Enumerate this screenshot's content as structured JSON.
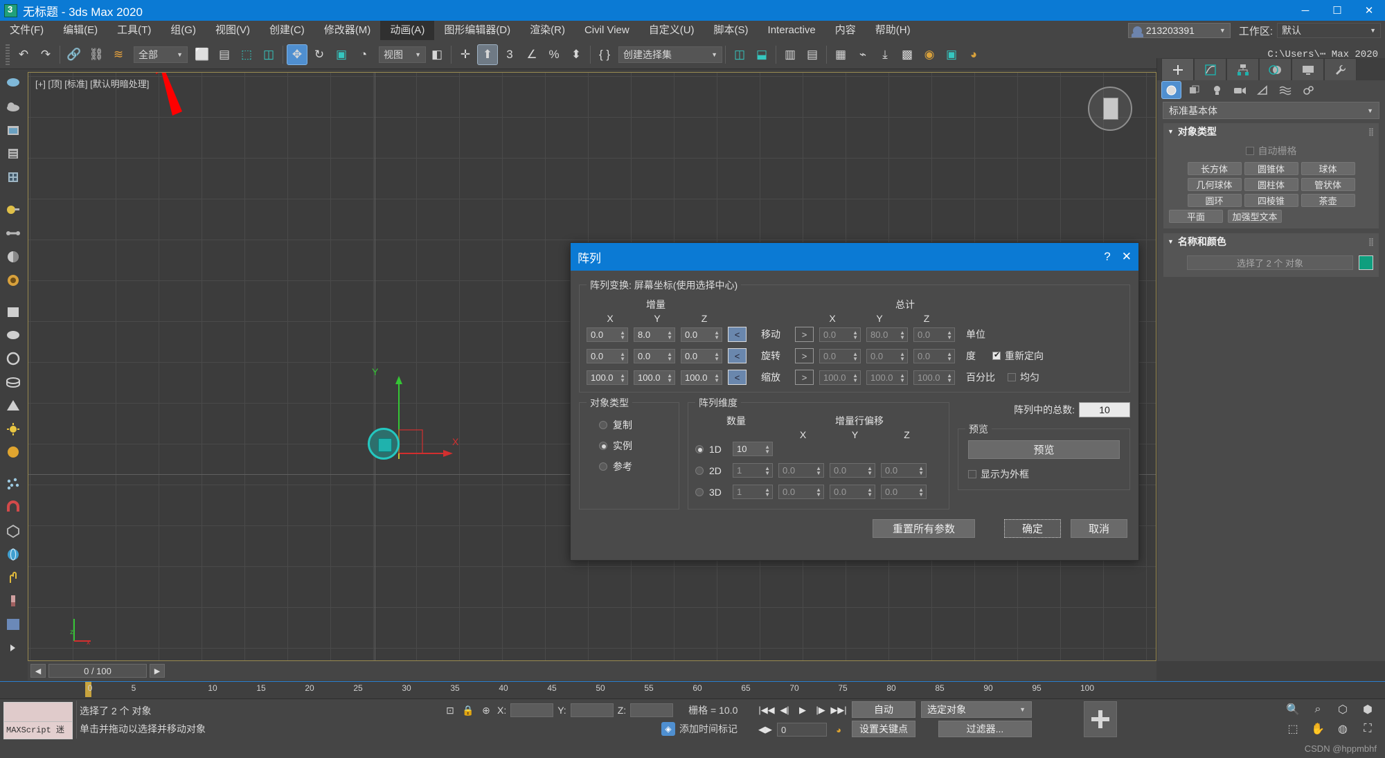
{
  "window": {
    "title": "无标题 - 3ds Max 2020",
    "icon": "3dsmax-icon",
    "controls": {
      "minimize": "─",
      "maximize": "☐",
      "close": "✕"
    }
  },
  "menubar": {
    "items": [
      {
        "label": "文件(F)",
        "active": false
      },
      {
        "label": "编辑(E)",
        "active": false
      },
      {
        "label": "工具(T)",
        "active": false
      },
      {
        "label": "组(G)",
        "active": false
      },
      {
        "label": "视图(V)",
        "active": false
      },
      {
        "label": "创建(C)",
        "active": false
      },
      {
        "label": "修改器(M)",
        "active": false
      },
      {
        "label": "动画(A)",
        "active": true
      },
      {
        "label": "图形编辑器(D)",
        "active": false
      },
      {
        "label": "渲染(R)",
        "active": false
      },
      {
        "label": "Civil View",
        "active": false
      },
      {
        "label": "自定义(U)",
        "active": false
      },
      {
        "label": "脚本(S)",
        "active": false
      },
      {
        "label": "Interactive",
        "active": false
      },
      {
        "label": "内容",
        "active": false
      },
      {
        "label": "帮助(H)",
        "active": false
      }
    ],
    "user_id": "213203391",
    "workspace_label": "工作区:",
    "workspace_value": "默认"
  },
  "toolbar": {
    "undo": "↶",
    "redo": "↷",
    "select_filter": "全部",
    "named_selection_sets": "创建选择集",
    "file_path": "C:\\Users\\⋯ Max 2020"
  },
  "viewport": {
    "label": "[+] [顶] [标准] [默认明暗处理]",
    "axis_x_label": "X",
    "axis_y_label": "Y",
    "axis_z_label": "Z",
    "corner_axis": "z"
  },
  "command_panel": {
    "tabs": [
      {
        "name": "create-tab",
        "icon": "plus-icon",
        "active": true
      },
      {
        "name": "modify-tab",
        "icon": "modify-icon",
        "active": false
      },
      {
        "name": "hierarchy-tab",
        "icon": "hierarchy-icon",
        "active": false
      },
      {
        "name": "motion-tab",
        "icon": "motion-icon",
        "active": false
      },
      {
        "name": "display-tab",
        "icon": "display-icon",
        "active": false
      },
      {
        "name": "utilities-tab",
        "icon": "wrench-icon",
        "active": false
      }
    ],
    "category_icons": [
      {
        "name": "geometry-icon",
        "glyph": "◯",
        "selected": true
      },
      {
        "name": "shapes-icon",
        "glyph": "◳",
        "selected": false
      },
      {
        "name": "lights-icon",
        "glyph": "♁",
        "selected": false
      },
      {
        "name": "cameras-icon",
        "glyph": "▤",
        "selected": false
      },
      {
        "name": "helpers-icon",
        "glyph": "◺",
        "selected": false
      },
      {
        "name": "spacewarps-icon",
        "glyph": "≋",
        "selected": false
      },
      {
        "name": "systems-icon",
        "glyph": "✿",
        "selected": false
      }
    ],
    "dropdown": "标准基本体",
    "rollouts": [
      {
        "title": "对象类型",
        "autogrid_label": "自动栅格",
        "autogrid_checked": false,
        "buttons": [
          "长方体",
          "圆锥体",
          "球体",
          "几何球体",
          "圆柱体",
          "管状体",
          "圆环",
          "四棱锥",
          "茶壶",
          "平面",
          "加强型文本"
        ]
      },
      {
        "title": "名称和颜色",
        "name_value": "选择了 2 个 对象",
        "color": "#0f9e7e"
      }
    ]
  },
  "timeline": {
    "prev_button": "◀",
    "next_button": "▶",
    "frame_display": "0 / 100",
    "ruler_ticks": [
      "0",
      "5",
      "10",
      "15",
      "20",
      "25",
      "30",
      "35",
      "40",
      "45",
      "50",
      "55",
      "60",
      "65",
      "70",
      "75",
      "80",
      "85",
      "90",
      "95",
      "100"
    ]
  },
  "statusbar": {
    "maxscript_label": "MAXScript 迷",
    "message_line1": "选择了 2 个 对象",
    "message_line2": "单击并拖动以选择并移动对象",
    "coord_x_label": "X:",
    "coord_y_label": "Y:",
    "coord_z_label": "Z:",
    "coord_x_value": "",
    "coord_y_value": "",
    "coord_z_value": "",
    "grid_text": "栅格 = 10.0",
    "add_time_tag": "添加时间标记",
    "frame_value": "0",
    "auto_key": "自动",
    "set_key": "设置关键点",
    "selected_object": "选定对象",
    "filter_button": "过滤器...",
    "watermark": "CSDN @hppmbhf"
  },
  "dialog": {
    "title": "阵列",
    "help_icon": "?",
    "close_icon": "✕",
    "transform_group_label": "阵列变换: 屏幕坐标(使用选择中心)",
    "incremental_header": "增量",
    "totals_header": "总计",
    "col_headers": [
      "X",
      "Y",
      "Z"
    ],
    "rows": [
      {
        "label": "移动",
        "incremental": [
          "0.0",
          "8.0",
          "0.0"
        ],
        "totals": [
          "0.0",
          "80.0",
          "0.0"
        ],
        "unit": "单位",
        "left_active": true,
        "extra_check_label": "",
        "extra_check_state": null
      },
      {
        "label": "旋转",
        "incremental": [
          "0.0",
          "0.0",
          "0.0"
        ],
        "totals": [
          "0.0",
          "0.0",
          "0.0"
        ],
        "unit": "度",
        "left_active": true,
        "extra_check_label": "重新定向",
        "extra_check_state": true
      },
      {
        "label": "缩放",
        "incremental": [
          "100.0",
          "100.0",
          "100.0"
        ],
        "totals": [
          "100.0",
          "100.0",
          "100.0"
        ],
        "unit": "百分比",
        "left_active": true,
        "extra_check_label": "均匀",
        "extra_check_state": false
      }
    ],
    "object_type_group": {
      "label": "对象类型",
      "options": [
        {
          "label": "复制",
          "selected": false
        },
        {
          "label": "实例",
          "selected": true
        },
        {
          "label": "参考",
          "selected": false
        }
      ]
    },
    "array_dimensions_group": {
      "label": "阵列维度",
      "count_header": "数量",
      "offset_header": "增量行偏移",
      "col_headers": [
        "X",
        "Y",
        "Z"
      ],
      "rows": [
        {
          "dim": "1D",
          "count": "10",
          "selected": true,
          "offsets": [
            "",
            "",
            ""
          ]
        },
        {
          "dim": "2D",
          "count": "1",
          "selected": false,
          "offsets": [
            "0.0",
            "0.0",
            "0.0"
          ]
        },
        {
          "dim": "3D",
          "count": "1",
          "selected": false,
          "offsets": [
            "0.0",
            "0.0",
            "0.0"
          ]
        }
      ]
    },
    "total_label": "阵列中的总数:",
    "total_value": "10",
    "preview_group_label": "预览",
    "preview_button": "预览",
    "show_as_box_label": "显示为外框",
    "show_as_box_checked": false,
    "reset_button": "重置所有参数",
    "ok_button": "确定",
    "cancel_button": "取消"
  }
}
